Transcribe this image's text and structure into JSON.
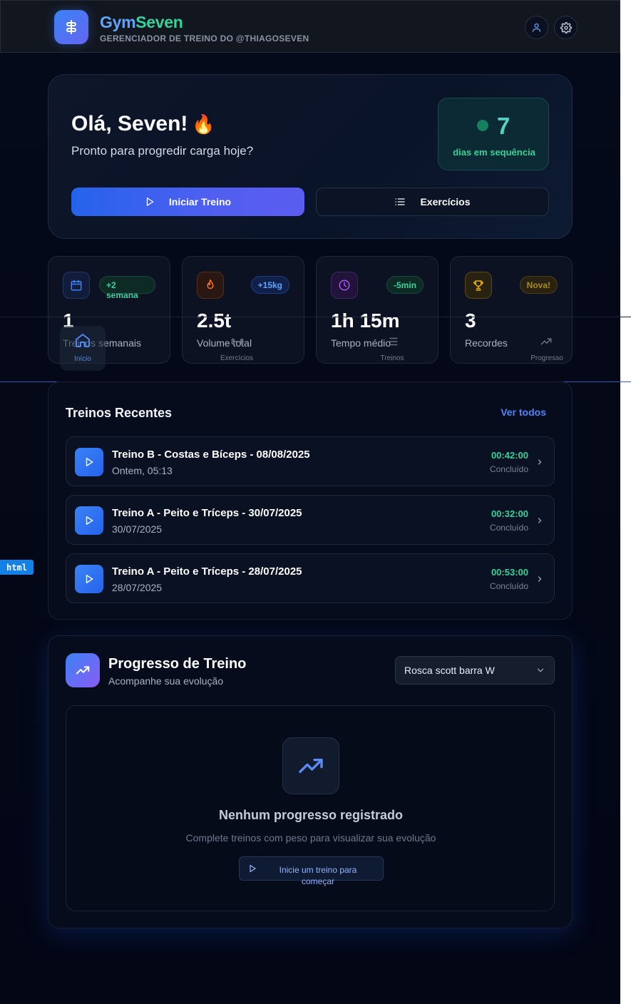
{
  "header": {
    "brand_part1": "Gym",
    "brand_part2": "Seven",
    "tagline": "GERENCIADOR DE TREINO DO @THIAGOSEVEN",
    "icons": [
      "dumbbell-icon",
      "user-icon",
      "gear-icon"
    ]
  },
  "hero": {
    "greeting": "Olá, Seven!",
    "greeting_emoji": "🔥",
    "subtitle": "Pronto para progredir carga hoje?",
    "streak_value": "7",
    "streak_label": "dias em sequência",
    "start_button": "Iniciar Treino",
    "exercises_button": "Exercícios"
  },
  "stats": [
    {
      "value": "1",
      "label": "Treinos semanais",
      "badge": "+2 semana",
      "badge_line1": "+2",
      "badge_line2": "semana",
      "icon": "calendar-icon",
      "color": "#3b82f6"
    },
    {
      "value": "2.5t",
      "label": "Volume total",
      "badge": "+15kg",
      "icon": "flame-icon",
      "color": "#f97316"
    },
    {
      "value": "1h 15m",
      "label": "Tempo médio",
      "badge": "-5min",
      "icon": "clock-icon",
      "color": "#a855f7"
    },
    {
      "value": "3",
      "label": "Recordes",
      "badge": "Nova!",
      "icon": "trophy-icon",
      "color": "#eab308"
    }
  ],
  "nav": {
    "items": [
      "Início",
      "Exercícios",
      "Treinos",
      "Progresso"
    ]
  },
  "recent": {
    "title": "Treinos Recentes",
    "see_all": "Ver todos",
    "rows": [
      {
        "title": "Treino B - Costas e Bíceps - 08/08/2025",
        "date": "Ontem, 05:13",
        "time": "00:42:00",
        "status": "Concluído"
      },
      {
        "title": "Treino A - Peito e Tríceps - 30/07/2025",
        "date": "30/07/2025",
        "time": "00:32:00",
        "status": "Concluído"
      },
      {
        "title": "Treino A - Peito e Tríceps - 28/07/2025",
        "date": "28/07/2025",
        "time": "00:53:00",
        "status": "Concluído"
      }
    ]
  },
  "progress": {
    "title": "Progresso de Treino",
    "subtitle": "Acompanhe sua evolução",
    "selected_exercise": "Rosca scott barra W",
    "empty_title": "Nenhum progresso registrado",
    "empty_subtitle": "Complete treinos com peso para visualizar sua evolução",
    "empty_button": "Inicie um treino para começar"
  },
  "devtools_tag": "html"
}
